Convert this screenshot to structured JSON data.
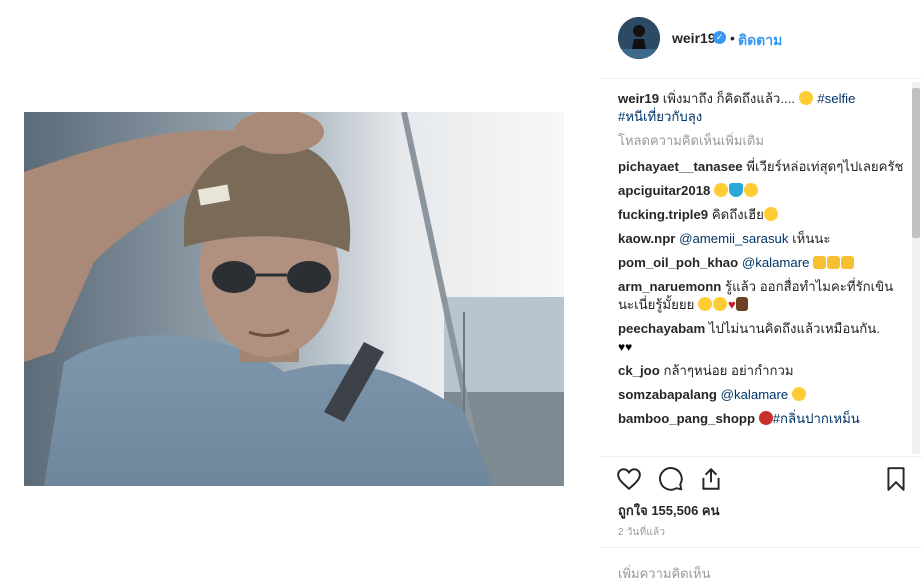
{
  "post": {
    "username": "weir19",
    "verified_icon": "verified-badge-icon",
    "separator": "•",
    "follow_label": "ติดตาม",
    "caption_text": " เพิ่งมาถึง ก็คิดถึงแล้ว.... ",
    "caption_tag1": "#selfie",
    "caption_tag2": "#หนีเที่ยวกับลุง",
    "load_more": "โหลดความคิดเห็นเพิ่มเติม",
    "likes_label": "ถูกใจ 155,506 คน",
    "time": "2 วันที่แล้ว",
    "add_comment_placeholder": "เพิ่มความคิดเห็น"
  },
  "comments": [
    {
      "user": "pichayaet__tanasee",
      "text": "พี่เวียร์หล่อเท่สุดๆไปเลยครัช"
    },
    {
      "user": "apciguitar2018",
      "text": ""
    },
    {
      "user": "fucking.triple9",
      "text": "คิดถึงเฮีย"
    },
    {
      "user": "kaow.npr",
      "mention": "@amemii_sarasuk",
      "text": " เห็นนะ"
    },
    {
      "user": "pom_oil_poh_khao",
      "mention": "@kalamare",
      "text": " "
    },
    {
      "user": "arm_naruemonn",
      "text": "รู้แล้ว ออกสื่อทำไมคะที่รักเขินนะเนี่ยรู้มั้ยยย "
    },
    {
      "user": "peechayabam",
      "text": "ไปไม่นานคิดถึงแล้วเหมือนกัน."
    },
    {
      "user": "ck_joo",
      "text": "กล้าๆหน่อย อย่ากำกวม"
    },
    {
      "user": "somzabapalang",
      "mention": "@kalamare",
      "text": " "
    },
    {
      "user": "bamboo_pang_shopp",
      "mention": "#กลิ่นปากเหม็น",
      "text": ""
    }
  ],
  "icons": {
    "like": "heart-outline-icon",
    "comment": "comment-bubble-icon",
    "share": "share-icon",
    "save": "bookmark-icon"
  },
  "colors": {
    "link": "#003569",
    "follow": "#3897f0",
    "muted": "#999999"
  }
}
